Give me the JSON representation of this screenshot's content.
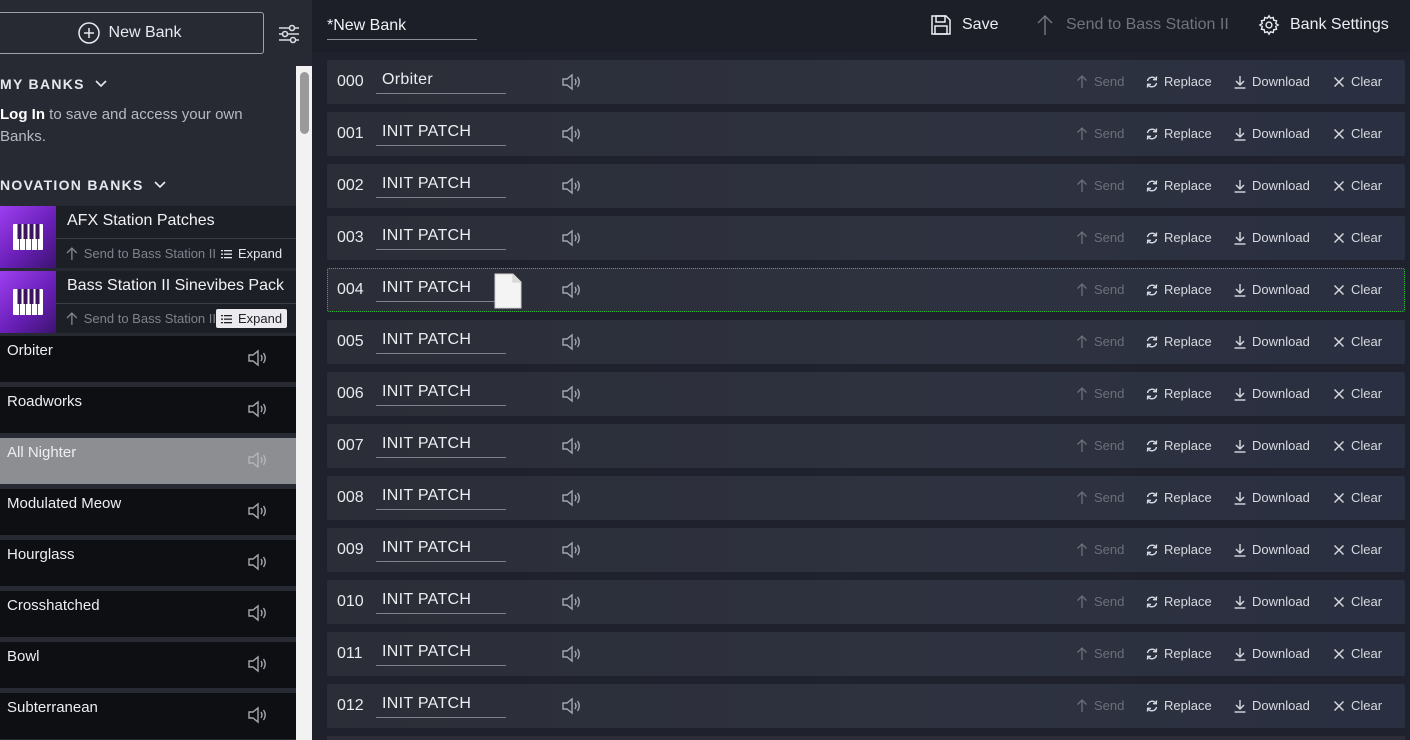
{
  "sidebar": {
    "new_bank_label": "New Bank",
    "my_banks_label": "MY BANKS",
    "login_link": "Log In",
    "login_rest": " to save and access your own Banks.",
    "novation_banks_label": "NOVATION BANKS",
    "bank_cards": [
      {
        "title": "AFX Station Patches",
        "send_label": "Send to Bass Station II",
        "expand_label": "Expand"
      },
      {
        "title": "Bass Station II Sinevibes Pack",
        "send_label": "Send to Bass Station II",
        "expand_label": "Expand"
      }
    ],
    "patches": [
      "Orbiter",
      "Roadworks",
      "All Nighter",
      "Modulated Meow",
      "Hourglass",
      "Crosshatched",
      "Bowl",
      "Subterranean"
    ]
  },
  "header": {
    "bank_name": "*New Bank",
    "save_label": "Save",
    "send_label": "Send to Bass Station II",
    "settings_label": "Bank Settings"
  },
  "row_actions": {
    "send": "Send",
    "replace": "Replace",
    "download": "Download",
    "clear": "Clear"
  },
  "rows": [
    {
      "num": "000",
      "name": "Orbiter"
    },
    {
      "num": "001",
      "name": "INIT PATCH"
    },
    {
      "num": "002",
      "name": "INIT PATCH"
    },
    {
      "num": "003",
      "name": "INIT PATCH"
    },
    {
      "num": "004",
      "name": "INIT PATCH"
    },
    {
      "num": "005",
      "name": "INIT PATCH"
    },
    {
      "num": "006",
      "name": "INIT PATCH"
    },
    {
      "num": "007",
      "name": "INIT PATCH"
    },
    {
      "num": "008",
      "name": "INIT PATCH"
    },
    {
      "num": "009",
      "name": "INIT PATCH"
    },
    {
      "num": "010",
      "name": "INIT PATCH"
    },
    {
      "num": "011",
      "name": "INIT PATCH"
    },
    {
      "num": "012",
      "name": "INIT PATCH"
    }
  ]
}
